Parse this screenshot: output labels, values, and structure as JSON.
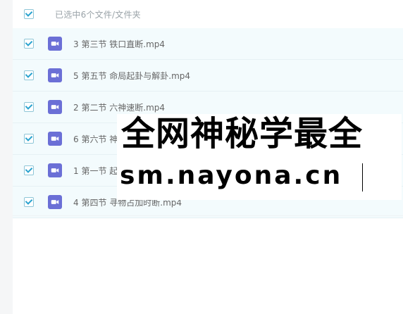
{
  "header": {
    "selected_label": "已选中6个文件/文件夹"
  },
  "files": [
    {
      "name": "3 第三节 铁口直断.mp4"
    },
    {
      "name": "5 第五节 命局起卦与解卦.mp4"
    },
    {
      "name": "2 第二节 六神速断.mp4"
    },
    {
      "name": "6 第六节 神"
    },
    {
      "name": "1 第一节 起"
    },
    {
      "name": "4 第四节 寻物占加时断.mp4"
    }
  ],
  "watermark": {
    "line1": "全网神秘学最全",
    "line2": "sm.nayona.cn"
  },
  "colors": {
    "row_bg": "#f3fbfd",
    "check": "#2aa3cf",
    "video_icon": "#6b6fd6"
  },
  "icons": {
    "file": "video-file-icon",
    "checkbox": "check-icon"
  }
}
